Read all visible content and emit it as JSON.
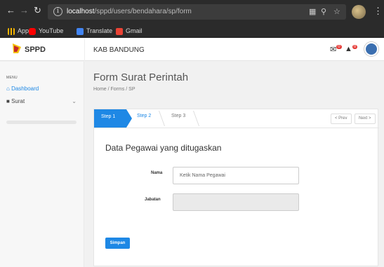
{
  "browser": {
    "back_icon": "arrow-left-icon",
    "forward_icon": "arrow-right-icon",
    "reload_icon": "reload-icon",
    "url_host": "localhost",
    "url_path": "/sppd/users/bendahara/sp/form",
    "bookmarks": [
      {
        "label": "Apps",
        "icon": "apps-grid-icon",
        "color": "#f4b400"
      },
      {
        "label": "YouTube",
        "icon": "youtube-icon",
        "color": "#ff0000"
      },
      {
        "label": "Translate",
        "icon": "translate-icon",
        "color": "#4285f4"
      },
      {
        "label": "Gmail",
        "icon": "gmail-icon",
        "color": "#ea4335"
      }
    ]
  },
  "header": {
    "logo_text": "SPPD",
    "org_name": "KAB BANDUNG",
    "notification_count_1": "0",
    "notification_count_2": "0"
  },
  "sidebar": {
    "menu_title": "MENU",
    "items": [
      {
        "label": "Dashboard",
        "icon": "home-icon",
        "active": true
      },
      {
        "label": "Surat",
        "icon": "folder-icon",
        "active": false
      }
    ]
  },
  "main": {
    "title": "Form Surat Perintah",
    "breadcrumb": "Home / Forms / SP",
    "steps": [
      "Step 1",
      "Step 2",
      "Step 3"
    ],
    "prev_label": "< Prev",
    "next_label": "Next >",
    "section_title": "Data Pegawai yang ditugaskan",
    "fields": [
      {
        "label": "Nama",
        "placeholder": "Ketik Nama Pegawai",
        "value": ""
      },
      {
        "label": "Jabatan",
        "placeholder": "",
        "value": "",
        "disabled": true
      }
    ],
    "submit_label": "Simpan"
  },
  "colors": {
    "accent": "#1e88e5",
    "chrome_bg": "#2b2b2b",
    "badge": "#e53935"
  }
}
